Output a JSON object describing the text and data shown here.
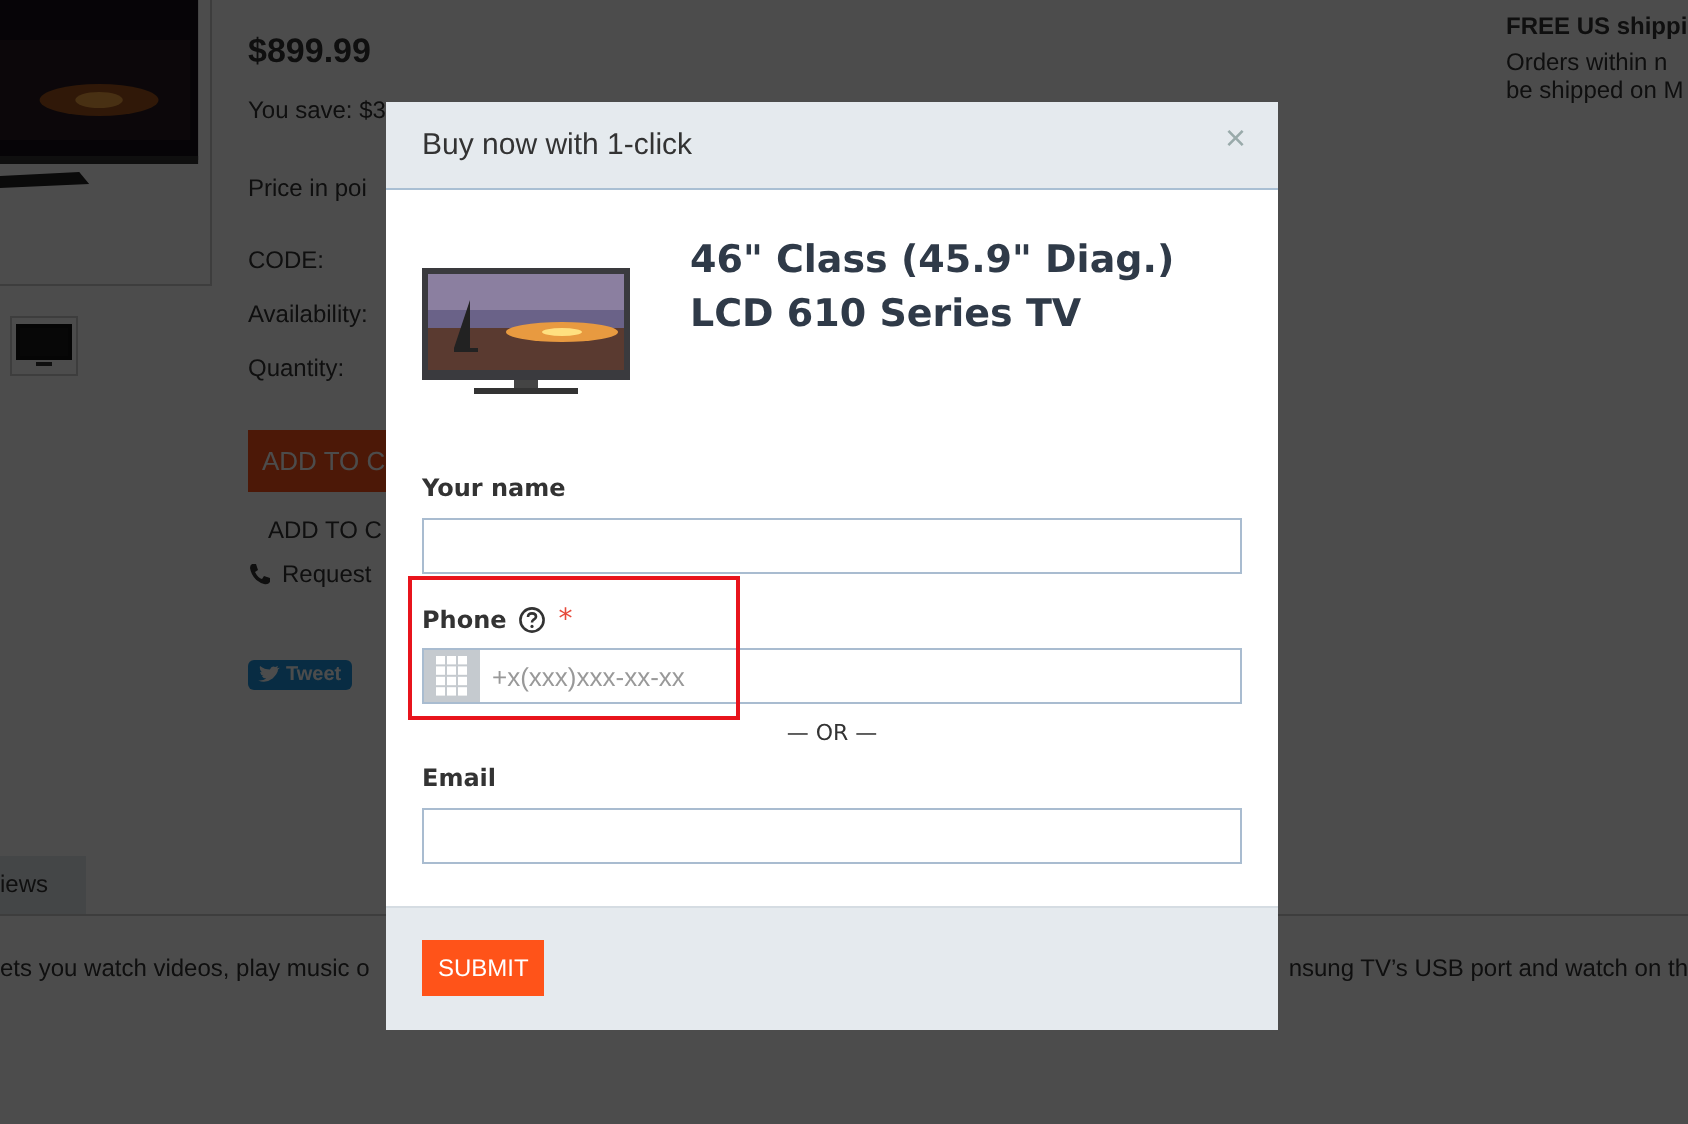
{
  "page": {
    "price": "$899.99",
    "savings": "You save: $3",
    "points": "Price in poi",
    "specs": [
      "CODE:",
      "Availability:",
      "Quantity:"
    ],
    "add_to_cart": "ADD TO C",
    "add_to_wishlist": "ADD TO C",
    "request": "Request",
    "tweet": "Tweet",
    "shipping": {
      "title": "FREE US shippi",
      "lines": [
        "Orders within n",
        "be shipped on M"
      ]
    },
    "tabs": [
      {
        "label": "iews",
        "selected": true
      }
    ],
    "description_left": "ets you watch videos, play music o",
    "description_right": "nsung TV’s USB port and watch on th"
  },
  "modal": {
    "title": "Buy now with 1-click",
    "close": "×",
    "product": "46\" Class (45.9\" Diag.) LCD 610 Series TV",
    "fields": [
      {
        "kind": "text",
        "label": "Your name"
      },
      {
        "kind": "phone",
        "label": "Phone",
        "help": true,
        "required_mark": "*",
        "placeholder": "+x(xxx)xxx-xx-xx",
        "highlighted": true
      },
      {
        "kind": "separator",
        "label": "— OR —"
      },
      {
        "kind": "text",
        "label": "Email"
      }
    ],
    "submit": "SUBMIT"
  }
}
